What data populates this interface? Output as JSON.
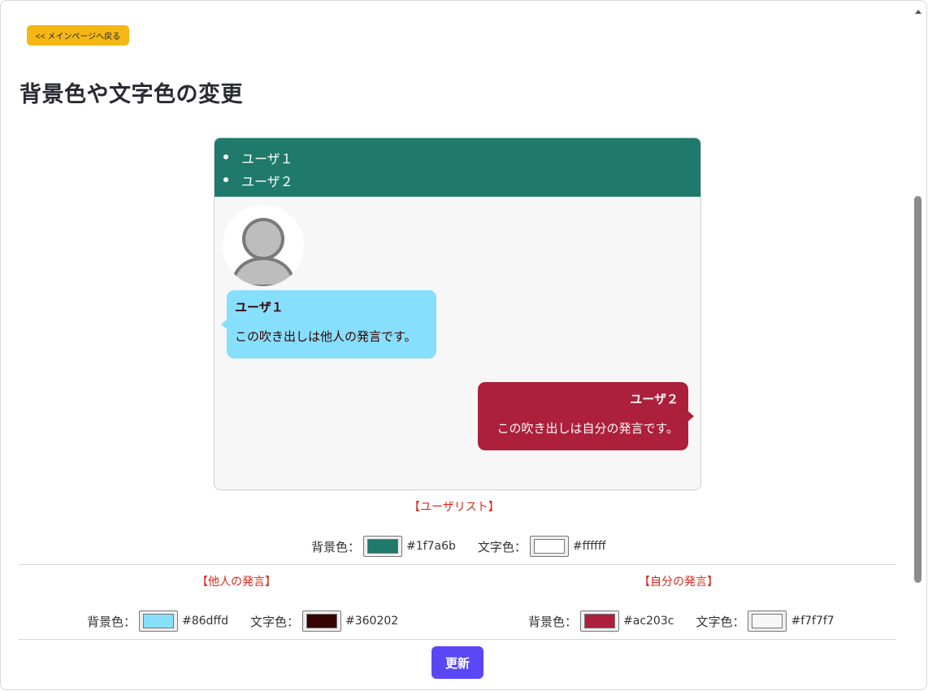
{
  "back_button": {
    "label": "<< メインページへ戻る"
  },
  "page_title": "背景色や文字色の変更",
  "preview": {
    "user_list": [
      "ユーザ１",
      "ユーザ２"
    ],
    "other_message": {
      "name": "ユーザ１",
      "text": "この吹き出しは他人の発言です。"
    },
    "self_message": {
      "name": "ユーザ２",
      "text": "この吹き出しは自分の発言です。"
    }
  },
  "user_list_section": {
    "title": "【ユーザリスト】",
    "bg_label": "背景色：",
    "bg_color": "#1f7a6b",
    "text_label": "文字色：",
    "text_color": "#ffffff"
  },
  "other_section": {
    "title": "【他人の発言】",
    "bg_label": "背景色：",
    "bg_color": "#86dffd",
    "text_label": "文字色：",
    "text_color": "#360202"
  },
  "self_section": {
    "title": "【自分の発言】",
    "bg_label": "背景色：",
    "bg_color": "#ac203c",
    "text_label": "文字色：",
    "text_color": "#f7f7f7"
  },
  "update_button": {
    "label": "更新"
  },
  "icons": {
    "avatar": "default-user-avatar-icon",
    "scroll": "scroll-up-arrow-icon"
  }
}
